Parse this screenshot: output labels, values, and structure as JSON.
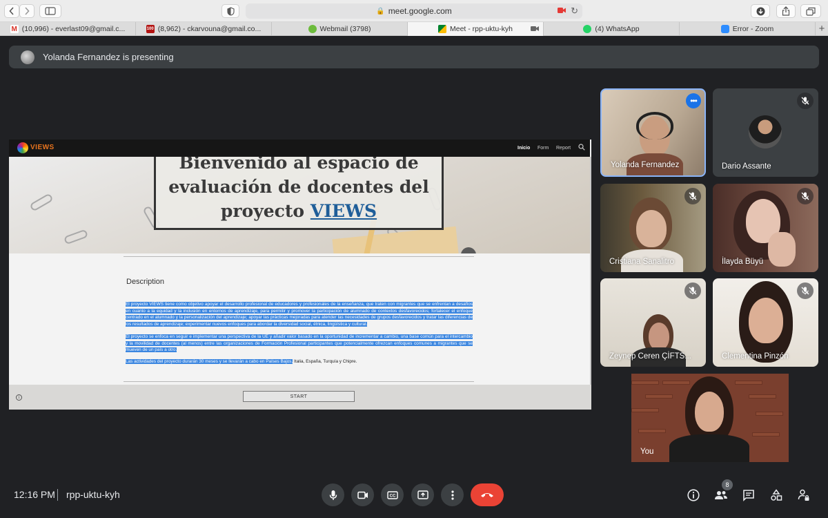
{
  "browser": {
    "url": "meet.google.com",
    "tabs": [
      {
        "label": "(10,996) - everlast09@gmail.c...",
        "icon": "gmail-icon",
        "color": "#d93025"
      },
      {
        "label": "(8,962) - ckarvouna@gmail.co...",
        "icon": "mail-icon",
        "color": "#b31412"
      },
      {
        "label": "Webmail (3798)",
        "icon": "webmail-icon",
        "color": "#6cbb3c"
      },
      {
        "label": "Meet - rpp-uktu-kyh",
        "icon": "meet-icon",
        "color": "#00832d"
      },
      {
        "label": "(4) WhatsApp",
        "icon": "whatsapp-icon",
        "color": "#25d366"
      },
      {
        "label": "Error - Zoom",
        "icon": "zoom-icon",
        "color": "#2d8cff"
      }
    ],
    "new_tab": "+"
  },
  "meet": {
    "presenting_banner": "Yolanda Fernandez is presenting",
    "clock": "12:16 PM",
    "meeting_code": "rpp-uktu-kyh",
    "participant_count": "8",
    "participants": [
      {
        "name": "Yolanda Fernandez",
        "muted": false
      },
      {
        "name": "Dario Assante",
        "muted": true
      },
      {
        "name": "Cristiana Sanalitro",
        "muted": true
      },
      {
        "name": "İlayda Büyü",
        "muted": true
      },
      {
        "name": "Zeynep Ceren ÇİFTS...",
        "muted": true
      },
      {
        "name": "Clementina Pinzón",
        "muted": true
      },
      {
        "name": "You",
        "muted": false
      }
    ]
  },
  "shared_screen": {
    "logo_text": "VIEWS",
    "nav": [
      "Inicio",
      "Form",
      "Report"
    ],
    "hero_line1": "Bienvenido al espacio de",
    "hero_line2": "evaluación de docentes del",
    "hero_line3_prefix": "proyecto ",
    "hero_link": "VIEWS",
    "description_heading": "Description",
    "para1_hl_a": "El proyecto VIEWS tiene como objetivo apoyar el desarrollo profesional de educadores y profesionales de la enseñanza, que traten con migrantes que se enfrentan a desafíos en cuanto a la equidad y la inclusión en entornos de aprendizaje, para permitir y promover la participación de alumnado de contextos desfavorecidos; fortalecer el enfoque centrado en el alumnado y la personalización del aprendizaje; apoyar las prácticas mejoradas para atender las necesidades de grupos desfavorecidos y tratar las diferencias de los resultados de aprendizaje; experimentar nuevos enfoques para abordar la diversidad social, étnica, lingüística y cultural.",
    "para2_hl": "El proyecto se enfoca en seguir e implementar una perspectiva de la UE y añadir valor basado en la oportunidad de incrementar a cambio, una base común para el intercambio y la movilidad de docentes (al menos) entre las organizaciones de Formación Profesional participantes que potencialmente ofrezcan enfoques comunes a migrantes que se mueven de un país a otro.",
    "para3_hl": "Las actividades del proyecto durarán 30 meses y se llevarán a cabo en Países Bajos,",
    "para3_rest": " Italia, España, Turquía y Chipre.",
    "start_button": "START"
  },
  "colors": {
    "meet_bg": "#202124",
    "hangup": "#ea4335",
    "accent": "#1a73e8",
    "selection": "#3b86e0"
  }
}
